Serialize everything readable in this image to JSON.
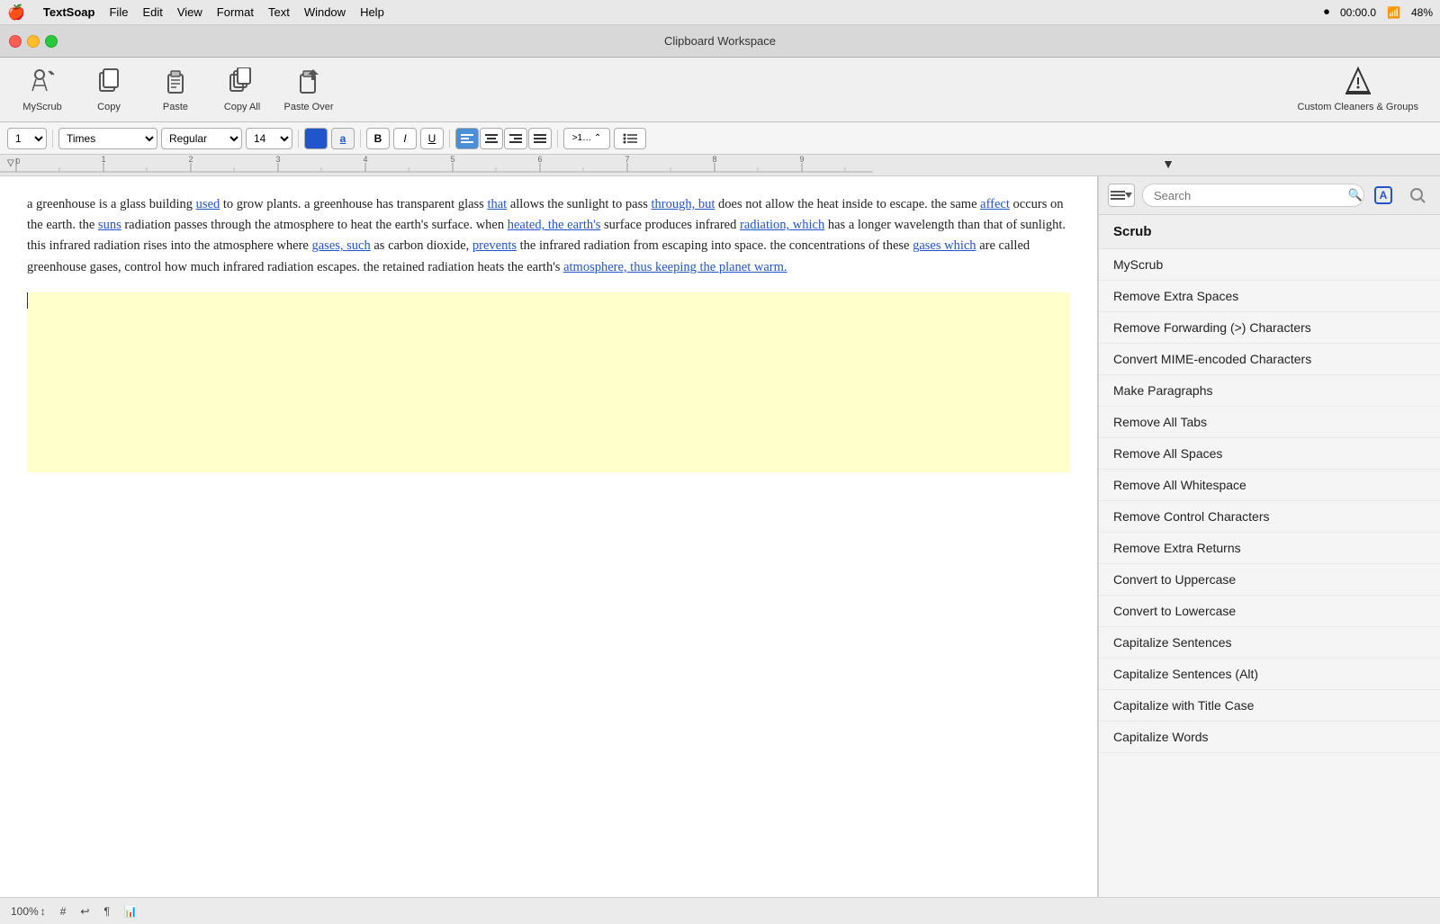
{
  "menubar": {
    "apple": "🍎",
    "app_name": "TextSoap",
    "items": [
      "File",
      "Edit",
      "View",
      "Format",
      "Text",
      "Window",
      "Help"
    ],
    "right": {
      "recording": "00:00.0",
      "wifi": "48%"
    }
  },
  "window": {
    "title": "Clipboard Workspace"
  },
  "toolbar": {
    "buttons": [
      {
        "id": "myscrub",
        "label": "MyScrub",
        "icon": "✦"
      },
      {
        "id": "copy",
        "label": "Copy",
        "icon": "⎘"
      },
      {
        "id": "paste",
        "label": "Paste",
        "icon": "📋"
      },
      {
        "id": "copyall",
        "label": "Copy All",
        "icon": "⊕"
      },
      {
        "id": "pasteover",
        "label": "Paste Over",
        "icon": "↷"
      }
    ],
    "custom_label": "Custom Cleaners & Groups",
    "custom_icon": "▲"
  },
  "format_bar": {
    "zoom_label": "1 ▾",
    "font": "Times",
    "style": "Regular",
    "size": "14",
    "bold": "B",
    "italic": "I",
    "underline": "U",
    "align_left": "≡",
    "align_center": "≡",
    "align_right": "≡",
    "align_justify": "≡",
    "list_num": ">1… ⌃",
    "list_bullet": "≡"
  },
  "text_content": {
    "paragraph": "a greenhouse is a glass building used to grow plants. a greenhouse has transparent glass that allows the sunlight to pass through, but does not allow the heat inside to escape. the same affect occurs on the earth. the suns radiation passes through the atmosphere to heat the earth's surface. when heated, the earth's surface produces infrared radiation, which has a longer wavelength than that of sunlight. this infrared radiation rises into the atmosphere where gases, such as carbon dioxide, prevents the infrared radiation from escaping into space. the concentrations of these gases which are called greenhouse gases, control how much infrared radiation escapes. the retained radiation heats the earth's atmosphere, thus keeping the planet warm.",
    "links": [
      "used",
      "that",
      "through, but",
      "affect",
      "suns",
      "heated, the earth's",
      "radiation, which",
      "gases, such",
      "prevents",
      "gases which",
      "atmosphere, thus keeping the planet warm."
    ]
  },
  "sidebar": {
    "search_placeholder": "Search",
    "items": [
      {
        "id": "scrub-header",
        "label": "Scrub",
        "type": "header"
      },
      {
        "id": "myscrub",
        "label": "MyScrub"
      },
      {
        "id": "remove-extra-spaces",
        "label": "Remove Extra Spaces"
      },
      {
        "id": "remove-forwarding",
        "label": "Remove Forwarding (>) Characters"
      },
      {
        "id": "convert-mime",
        "label": "Convert MIME-encoded Characters"
      },
      {
        "id": "make-paragraphs",
        "label": "Make Paragraphs"
      },
      {
        "id": "remove-all-tabs",
        "label": "Remove All Tabs"
      },
      {
        "id": "remove-all-spaces",
        "label": "Remove All Spaces"
      },
      {
        "id": "remove-all-whitespace",
        "label": "Remove All Whitespace"
      },
      {
        "id": "remove-control-chars",
        "label": "Remove Control Characters"
      },
      {
        "id": "remove-extra-returns",
        "label": "Remove Extra Returns"
      },
      {
        "id": "convert-uppercase",
        "label": "Convert to Uppercase"
      },
      {
        "id": "convert-lowercase",
        "label": "Convert to Lowercase"
      },
      {
        "id": "capitalize-sentences",
        "label": "Capitalize Sentences"
      },
      {
        "id": "capitalize-sentences-alt",
        "label": "Capitalize Sentences (Alt)"
      },
      {
        "id": "capitalize-title",
        "label": "Capitalize with Title Case"
      },
      {
        "id": "capitalize-words",
        "label": "Capitalize Words"
      }
    ]
  },
  "status_bar": {
    "zoom": "100%",
    "zoom_arrows": "↕",
    "hash": "#",
    "undo": "↩",
    "paragraph": "¶",
    "stats": "📊"
  }
}
